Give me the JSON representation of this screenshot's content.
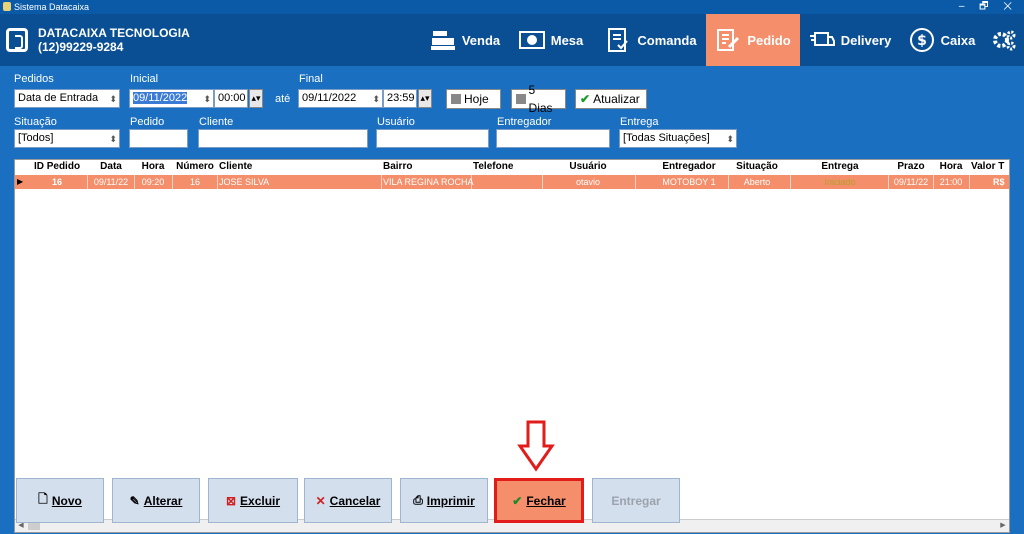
{
  "window": {
    "title": "Sistema Datacaixa",
    "controls": "– 🗗 ✕"
  },
  "company": {
    "name": "DATACAIXA TECNOLOGIA",
    "phone": "(12)99229-9284"
  },
  "nav": [
    {
      "label": "Venda",
      "icon": "cash-register-icon"
    },
    {
      "label": "Mesa",
      "icon": "plate-icon"
    },
    {
      "label": "Comanda",
      "icon": "checklist-icon"
    },
    {
      "label": "Pedido",
      "icon": "order-edit-icon",
      "active": true
    },
    {
      "label": "Delivery",
      "icon": "delivery-truck-icon"
    },
    {
      "label": "Caixa",
      "icon": "dollar-coin-icon"
    },
    {
      "label": "",
      "icon": "gears-icon"
    }
  ],
  "filters": {
    "pedidos_label": "Pedidos",
    "pedidos_value": "Data de Entrada",
    "inicial_label": "Inicial",
    "inicial_date": "09/11/2022",
    "inicial_time": "00:00",
    "ate": "até",
    "final_label": "Final",
    "final_date": "09/11/2022",
    "final_time": "23:59",
    "hoje": "Hoje",
    "cinco_dias": "5 Dias",
    "atualizar": "Atualizar",
    "situacao_label": "Situação",
    "situacao_value": "[Todos]",
    "pedido_label": "Pedido",
    "cliente_label": "Cliente",
    "usuario_label": "Usuário",
    "entregador_label": "Entregador",
    "entrega_label": "Entrega",
    "entrega_value": "[Todas Situações]"
  },
  "grid": {
    "columns": [
      "ID Pedido",
      "Data",
      "Hora",
      "Número",
      "Cliente",
      "Bairro",
      "Telefone",
      "Usuário",
      "Entregador",
      "Situação",
      "Entrega",
      "Prazo",
      "Hora",
      "Valor T"
    ],
    "rows": [
      [
        "16",
        "09/11/22",
        "09:20",
        "16",
        "JOSE SILVA",
        "VILA REGINA ROCHA",
        "",
        "otavio",
        "MOTOBOY 1",
        "Aberto",
        "Iniciado",
        "09/11/22",
        "21:00",
        "R$"
      ]
    ]
  },
  "buttons": {
    "novo": "Novo",
    "alterar": "Alterar",
    "excluir": "Excluir",
    "cancelar": "Cancelar",
    "imprimir": "Imprimir",
    "fechar": "Fechar",
    "entregar": "Entregar"
  },
  "colors": {
    "accent": "#f58e6b",
    "header": "#0a4f94",
    "bg": "#1a6fc0",
    "highlight_border": "#e21b1b"
  }
}
